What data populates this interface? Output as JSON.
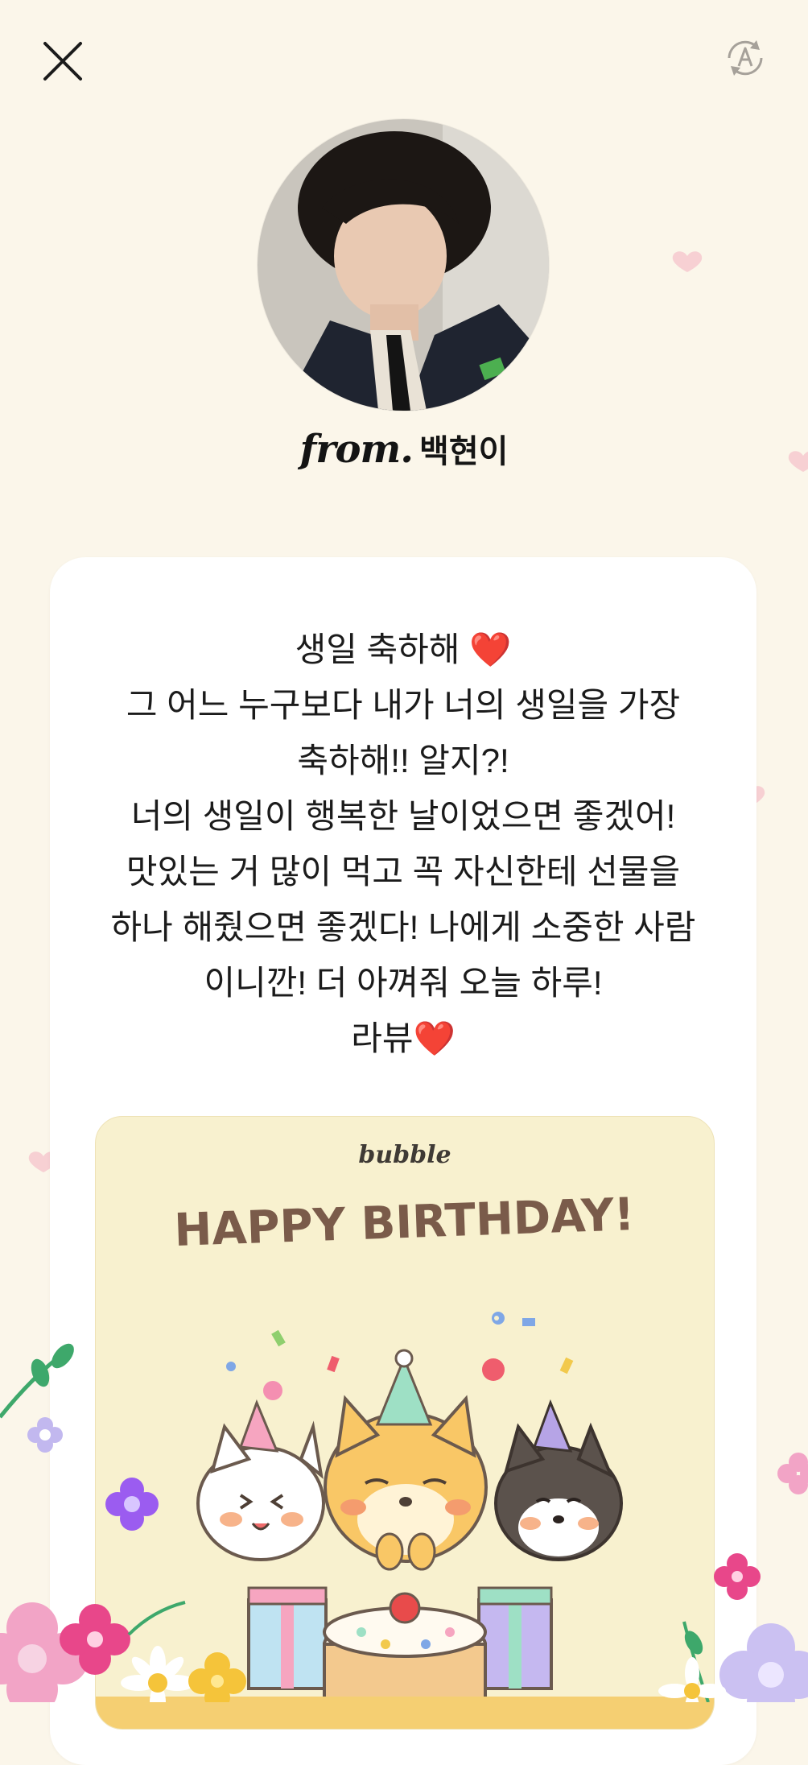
{
  "from": {
    "prefix": "from.",
    "name": "백현이"
  },
  "message": {
    "lines": [
      "생일 축하해",
      "그 어느 누구보다 내가 너의 생일을 가장",
      "축하해!! 알지?!",
      "너의 생일이 행복한 날이었으면 좋겠어!",
      "맛있는 거 많이 먹고 꼭 자신한테 선물을",
      "하나 해줬으면 좋겠다! 나에게 소중한 사람",
      "이니깐! 더 아껴줘 오늘 하루!",
      "라뷰"
    ],
    "heart_emoji": "❤️"
  },
  "birthday_card": {
    "brand": "bubble",
    "headline": "HAPPY BIRTHDAY!"
  },
  "icons": {
    "close": "close-icon",
    "translate": "translate-icon"
  },
  "colors": {
    "background": "#fbf6ea",
    "card": "#ffffff",
    "card_image_bg": "#f8f1cf",
    "headline": "#7a5b4a",
    "heart": "#e53935"
  }
}
